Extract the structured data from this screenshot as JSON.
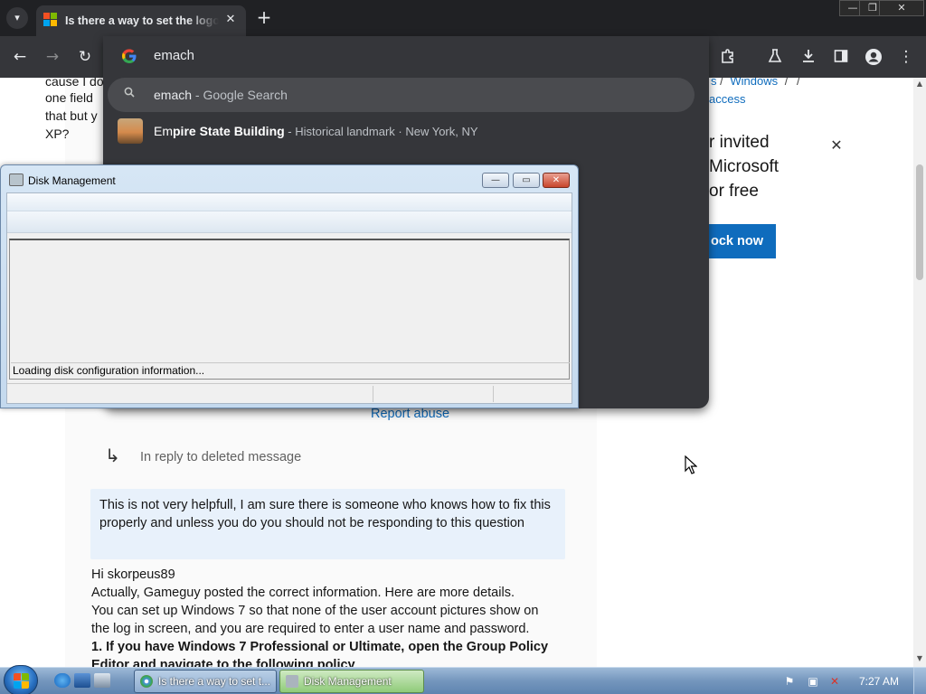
{
  "browser": {
    "tab": {
      "title": "Is there a way to set the logon",
      "close_glyph": "✕"
    },
    "new_tab_glyph": "+",
    "window_controls": {
      "minimize": "—",
      "restore": "❐",
      "close": "✕"
    },
    "toolbar": {
      "back": "←",
      "forward": "→",
      "reload": "↻",
      "menu": "⋮"
    },
    "omnibox": {
      "input_value": "emach",
      "suggestions": [
        {
          "icon": "search-icon",
          "text": "emach",
          "suffix": " - Google Search"
        },
        {
          "icon": "place-thumbnail",
          "text_match": "Em",
          "text_rest": "pire State Building",
          "separator": " - ",
          "description": "Historical landmark · New York, NY"
        }
      ]
    }
  },
  "page": {
    "fragment_lines": [
      "cause I do",
      "one field",
      "that but y",
      "XP?"
    ],
    "breadcrumb": [
      "s",
      "/",
      "Windows",
      "/",
      "/"
    ],
    "breadcrumb_line2": "access",
    "promo_lines": [
      "r invited",
      "Microsoft",
      "or free"
    ],
    "promo_button": "ock now",
    "report_abuse": "Report abuse",
    "reply_label": "In reply to deleted message",
    "quote_text": "This is not very helpfull, I am sure there is someone who knows how to fix this properly and unless you do you should not be responding to this question",
    "answer": {
      "greeting": "Hi skorpeus89",
      "lines": [
        "Actually, Gameguy posted the correct information. Here are more details.",
        "You can set up Windows 7 so that none of the user account pictures show on",
        "the log in screen, and you are required to enter a user name and password."
      ],
      "bold_lines": [
        "1. If you have Windows 7 Professional or Ultimate, open the Group Policy",
        "Editor and navigate to the following policy"
      ]
    }
  },
  "disk_management": {
    "title": "Disk Management",
    "status_text": "Loading disk configuration information...",
    "buttons": {
      "minimize": "—",
      "maximize": "▭",
      "close": "✕"
    }
  },
  "taskbar": {
    "tasks": [
      {
        "label": "Is there a way to set t..."
      },
      {
        "label": "Disk Management"
      }
    ],
    "clock": "7:27 AM"
  },
  "colors": {
    "accent": "#0f6cbd",
    "chrome_dark": "#35363a",
    "quote_bg": "#e8f1fb"
  }
}
